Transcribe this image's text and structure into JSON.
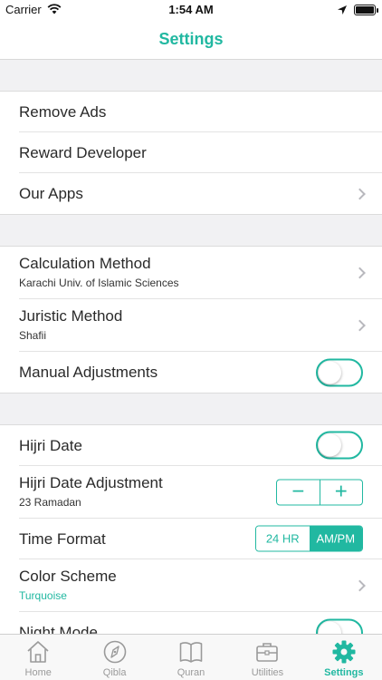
{
  "status_bar": {
    "carrier": "Carrier",
    "time": "1:54 AM"
  },
  "nav": {
    "title": "Settings"
  },
  "groups": [
    {
      "rows": [
        {
          "label": "Remove Ads"
        },
        {
          "label": "Reward Developer"
        },
        {
          "label": "Our Apps"
        }
      ]
    },
    {
      "rows": [
        {
          "label": "Calculation Method",
          "sub": "Karachi Univ. of Islamic Sciences"
        },
        {
          "label": "Juristic Method",
          "sub": "Shafii"
        },
        {
          "label": "Manual Adjustments"
        }
      ]
    },
    {
      "rows": [
        {
          "label": "Hijri Date"
        },
        {
          "label": "Hijri Date Adjustment",
          "sub": "23 Ramadan"
        },
        {
          "label": "Time Format"
        },
        {
          "label": "Color Scheme",
          "sub": "Turquoise"
        },
        {
          "label": "Night Mode"
        }
      ]
    }
  ],
  "stepper": {
    "minus": "−",
    "plus": "+"
  },
  "time_format": {
    "options": [
      "24 HR",
      "AM/PM"
    ],
    "selected": "AM/PM"
  },
  "toggles": {
    "manual_adjustments": false,
    "hijri_date": false,
    "night_mode": false
  },
  "tabs": [
    {
      "label": "Home",
      "icon": "home-icon"
    },
    {
      "label": "Qibla",
      "icon": "compass-icon"
    },
    {
      "label": "Quran",
      "icon": "book-icon"
    },
    {
      "label": "Utilities",
      "icon": "briefcase-icon"
    },
    {
      "label": "Settings",
      "icon": "gear-icon",
      "active": true
    }
  ],
  "colors": {
    "accent": "#21b8a1",
    "inactive": "#9a9a9a"
  }
}
